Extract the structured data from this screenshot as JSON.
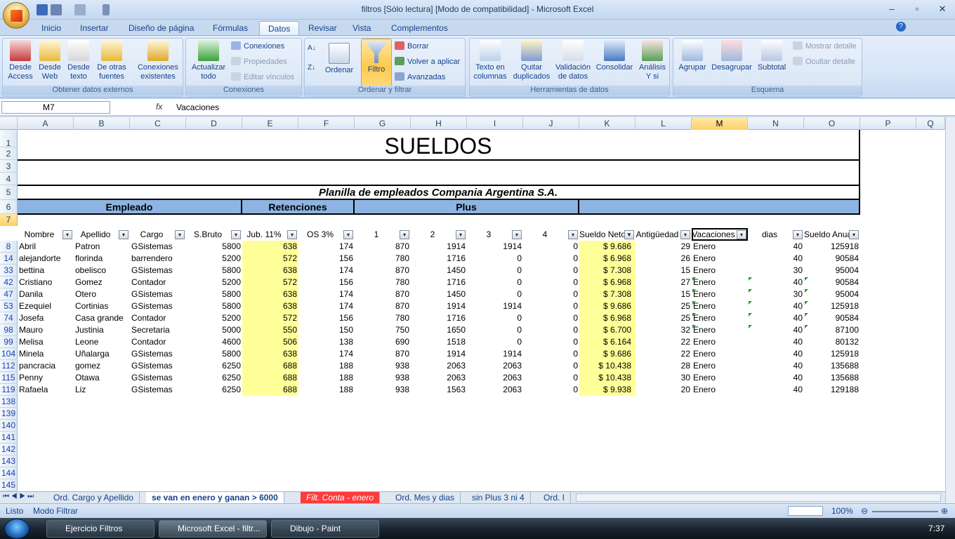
{
  "window": {
    "title": "filtros  [Sólo lectura]  [Modo de compatibilidad] - Microsoft Excel",
    "min": "–",
    "max": "▫",
    "close": "✕"
  },
  "ribbon_tabs": [
    "Inicio",
    "Insertar",
    "Diseño de página",
    "Fórmulas",
    "Datos",
    "Revisar",
    "Vista",
    "Complementos"
  ],
  "groups": {
    "externos": {
      "label": "Obtener datos externos",
      "buttons": [
        "Desde Access",
        "Desde Web",
        "Desde texto",
        "De otras fuentes",
        "Conexiones existentes"
      ]
    },
    "conexiones": {
      "label": "Conexiones",
      "big": "Actualizar todo",
      "small": [
        "Conexiones",
        "Propiedades",
        "Editar vínculos"
      ]
    },
    "ordenar": {
      "label": "Ordenar y filtrar",
      "ordenar": "Ordenar",
      "filtro": "Filtro",
      "small": [
        "Borrar",
        "Volver a aplicar",
        "Avanzadas"
      ]
    },
    "herramientas": {
      "label": "Herramientas de datos",
      "buttons": [
        "Texto en columnas",
        "Quitar duplicados",
        "Validación de datos",
        "Consolidar",
        "Análisis Y si"
      ]
    },
    "esquema": {
      "label": "Esquema",
      "buttons": [
        "Agrupar",
        "Desagrupar",
        "Subtotal"
      ],
      "small": [
        "Mostrar detalle",
        "Ocultar detalle"
      ]
    }
  },
  "formula_bar": {
    "name_box": "M7",
    "fx": "fx",
    "value": "Vacaciones"
  },
  "columns": [
    "A",
    "B",
    "C",
    "D",
    "E",
    "F",
    "G",
    "H",
    "I",
    "J",
    "K",
    "L",
    "M",
    "N",
    "O",
    "P",
    "Q"
  ],
  "sheet": {
    "title": "SUELDOS",
    "subtitle": "Planilla de empleados Compania Argentina S.A.",
    "groups": [
      "Empleado",
      "Retenciones",
      "Plus"
    ],
    "headers": [
      "Nombre",
      "Apellido",
      "Cargo",
      "S.Bruto",
      "Jub. 11%",
      "OS 3%",
      "1",
      "2",
      "3",
      "4",
      "Sueldo Neto",
      "Antigüedad",
      "Vacaciones",
      "dias",
      "Sueldo Anual"
    ],
    "top_rows": [
      "1",
      "2",
      "3",
      "4",
      "5",
      "6",
      "7"
    ],
    "rows": [
      {
        "n": "8",
        "c": [
          "Abril",
          "Patron",
          "GSistemas",
          "5800",
          "638",
          "174",
          "870",
          "1914",
          "1914",
          "0",
          "$ 9.686",
          "29",
          "Enero",
          "40",
          "125918"
        ]
      },
      {
        "n": "14",
        "c": [
          "alejandorte",
          "florinda",
          "barrendero",
          "5200",
          "572",
          "156",
          "780",
          "1716",
          "0",
          "0",
          "$ 6.968",
          "26",
          "Enero",
          "40",
          "90584"
        ]
      },
      {
        "n": "33",
        "c": [
          "bettina",
          "obelisco",
          "GSistemas",
          "5800",
          "638",
          "174",
          "870",
          "1450",
          "0",
          "0",
          "$ 7.308",
          "15",
          "Enero",
          "30",
          "95004"
        ]
      },
      {
        "n": "42",
        "c": [
          "Cristiano",
          "Gomez",
          "Contador",
          "5200",
          "572",
          "156",
          "780",
          "1716",
          "0",
          "0",
          "$ 6.968",
          "27",
          "Enero",
          "40",
          "90584"
        ]
      },
      {
        "n": "47",
        "c": [
          "Danila",
          "Otero",
          "GSistemas",
          "5800",
          "638",
          "174",
          "870",
          "1450",
          "0",
          "0",
          "$ 7.308",
          "15",
          "Enero",
          "30",
          "95004"
        ]
      },
      {
        "n": "53",
        "c": [
          "Ezequiel",
          "Cortinias",
          "GSistemas",
          "5800",
          "638",
          "174",
          "870",
          "1914",
          "1914",
          "0",
          "$ 9.686",
          "25",
          "Enero",
          "40",
          "125918"
        ]
      },
      {
        "n": "74",
        "c": [
          "Josefa",
          "Casa grande",
          "Contador",
          "5200",
          "572",
          "156",
          "780",
          "1716",
          "0",
          "0",
          "$ 6.968",
          "25",
          "Enero",
          "40",
          "90584"
        ]
      },
      {
        "n": "98",
        "c": [
          "Mauro",
          "Justinia",
          "Secretaria",
          "5000",
          "550",
          "150",
          "750",
          "1650",
          "0",
          "0",
          "$ 6.700",
          "32",
          "Enero",
          "40",
          "87100"
        ]
      },
      {
        "n": "99",
        "c": [
          "Melisa",
          "Leone",
          "Contador",
          "4600",
          "506",
          "138",
          "690",
          "1518",
          "0",
          "0",
          "$ 6.164",
          "22",
          "Enero",
          "40",
          "80132"
        ]
      },
      {
        "n": "104",
        "c": [
          "Minela",
          "Uñalarga",
          "GSistemas",
          "5800",
          "638",
          "174",
          "870",
          "1914",
          "1914",
          "0",
          "$ 9.686",
          "22",
          "Enero",
          "40",
          "125918"
        ]
      },
      {
        "n": "112",
        "c": [
          "pancracia",
          "gomez",
          "GSistemas",
          "6250",
          "688",
          "188",
          "938",
          "2063",
          "2063",
          "0",
          "$ 10.438",
          "28",
          "Enero",
          "40",
          "135688"
        ]
      },
      {
        "n": "115",
        "c": [
          "Penny",
          "Otawa",
          "GSistemas",
          "6250",
          "688",
          "188",
          "938",
          "2063",
          "2063",
          "0",
          "$ 10.438",
          "30",
          "Enero",
          "40",
          "135688"
        ]
      },
      {
        "n": "119",
        "c": [
          "Rafaela",
          "Liz",
          "GSistemas",
          "6250",
          "688",
          "188",
          "938",
          "1563",
          "2063",
          "0",
          "$ 9.938",
          "20",
          "Enero",
          "40",
          "129188"
        ]
      }
    ],
    "empty_rows": [
      "138",
      "139",
      "140",
      "141",
      "142",
      "143",
      "144",
      "145"
    ]
  },
  "sheet_tabs": [
    "Ord. Cargo y Apellido",
    "se van en enero y ganan > 6000",
    "Filt. Conta - enero",
    "Ord. Mes y dias",
    "sin Plus 3 ni 4",
    "Ord. I"
  ],
  "status": {
    "listo": "Listo",
    "mode": "Modo Filtrar",
    "zoom": "100%"
  },
  "taskbar": {
    "items": [
      "Ejercicio Filtros",
      "Microsoft Excel - filtr...",
      "Dibujo - Paint"
    ],
    "clock": "7:37"
  },
  "colors": {
    "highlight": "#ffff99",
    "group_header": "#8db4e2",
    "active_tab": "#ff3b3b"
  }
}
